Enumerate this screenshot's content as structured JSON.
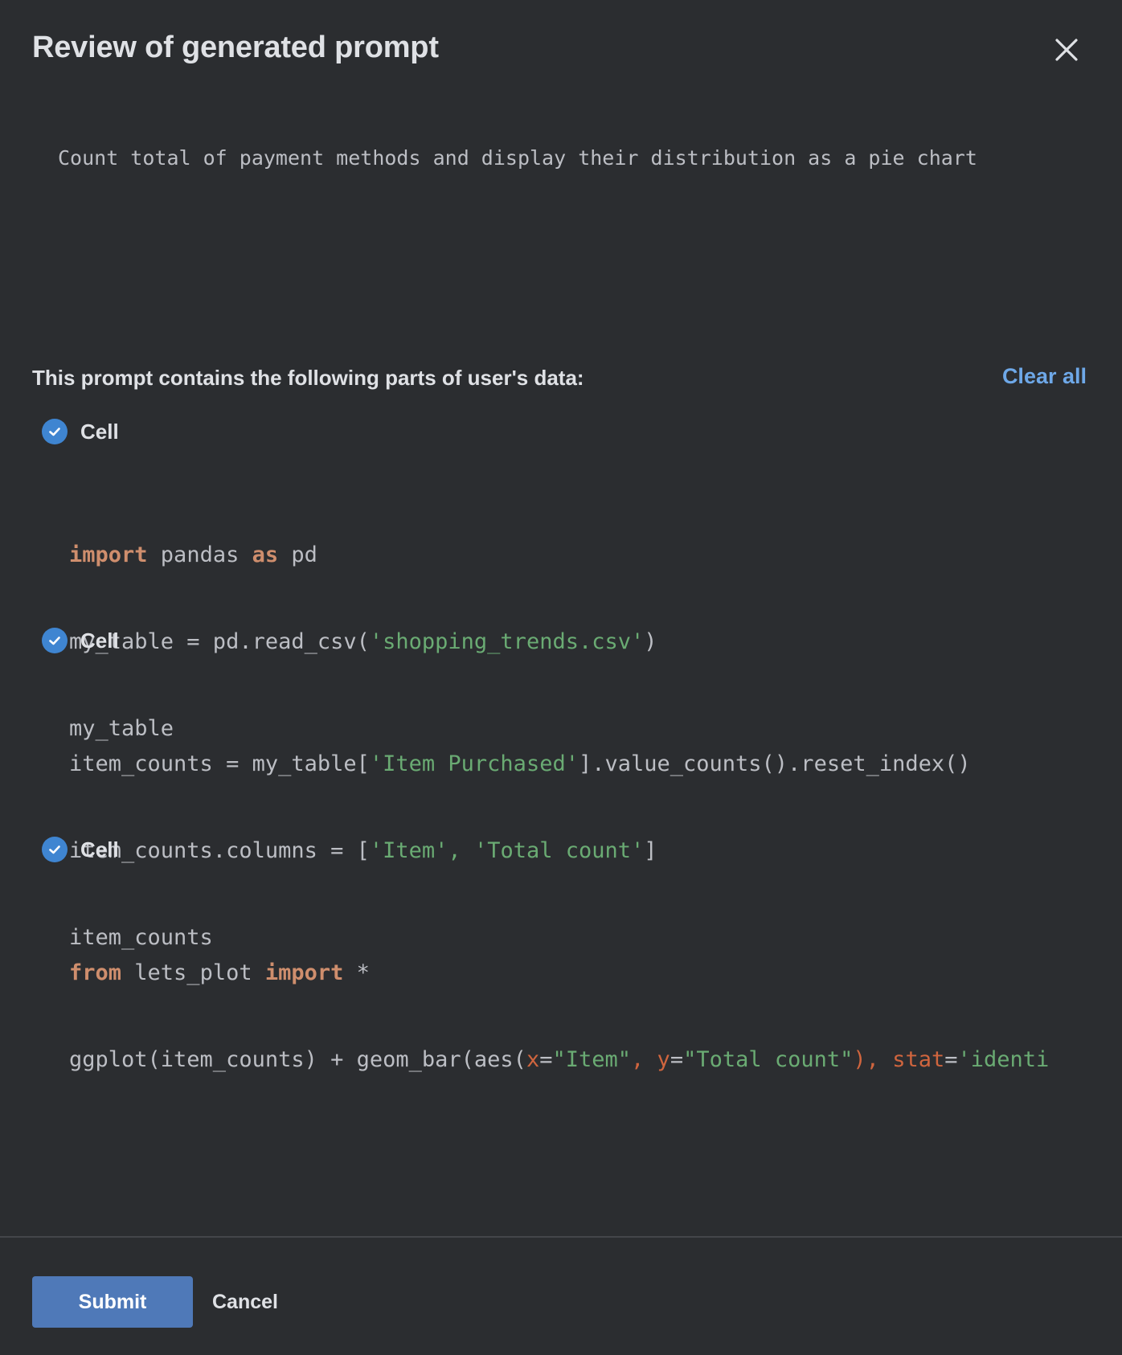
{
  "dialog": {
    "title": "Review of generated prompt",
    "close_icon": "close-icon"
  },
  "prompt": {
    "text": "Count total of payment methods and display their distribution as a pie chart"
  },
  "data_section": {
    "header": "This prompt contains the following parts of user's data:",
    "clear_all_label": "Clear all"
  },
  "cells": [
    {
      "label": "Cell",
      "checked": true,
      "code": {
        "l1_kw1": "import",
        "l1_t1": " pandas ",
        "l1_kw2": "as",
        "l1_t2": " pd",
        "l2_t1": "my_table = pd.read_csv(",
        "l2_s1": "'shopping_trends.csv'",
        "l2_t2": ")",
        "l3_t1": "my_table"
      }
    },
    {
      "label": "Cell",
      "checked": true,
      "code": {
        "l1_t1": "item_counts = my_table[",
        "l1_s1": "'Item Purchased'",
        "l1_t2": "].value_counts().reset_index()",
        "l2_t1": "item_counts.columns = [",
        "l2_s1": "'Item'",
        "l2_t2": ", ",
        "l2_s2": "'Total count'",
        "l2_t3": "]",
        "l3_t1": "item_counts"
      }
    },
    {
      "label": "Cell",
      "checked": true,
      "code": {
        "l1_kw1": "from",
        "l1_t1": " lets_plot ",
        "l1_kw2": "import",
        "l1_t2": " *",
        "l2_t1": "ggplot(item_counts) + geom_bar(aes(",
        "l2_p1": "x",
        "l2_t2": "=",
        "l2_s1": "\"Item\"",
        "l2_t3": ", ",
        "l2_p2": "y",
        "l2_t4": "=",
        "l2_s2": "\"Total count\"",
        "l2_t5": "), ",
        "l2_p3": "stat",
        "l2_t6": "=",
        "l2_s3": "'identi"
      }
    }
  ],
  "footer": {
    "submit_label": "Submit",
    "cancel_label": "Cancel"
  },
  "colors": {
    "background": "#2b2d30",
    "accent": "#3f85d1",
    "link": "#6ea8e8",
    "submit": "#4f79b8",
    "keyword": "#cf8e6d",
    "string": "#6aab73",
    "param": "#d0653e"
  }
}
